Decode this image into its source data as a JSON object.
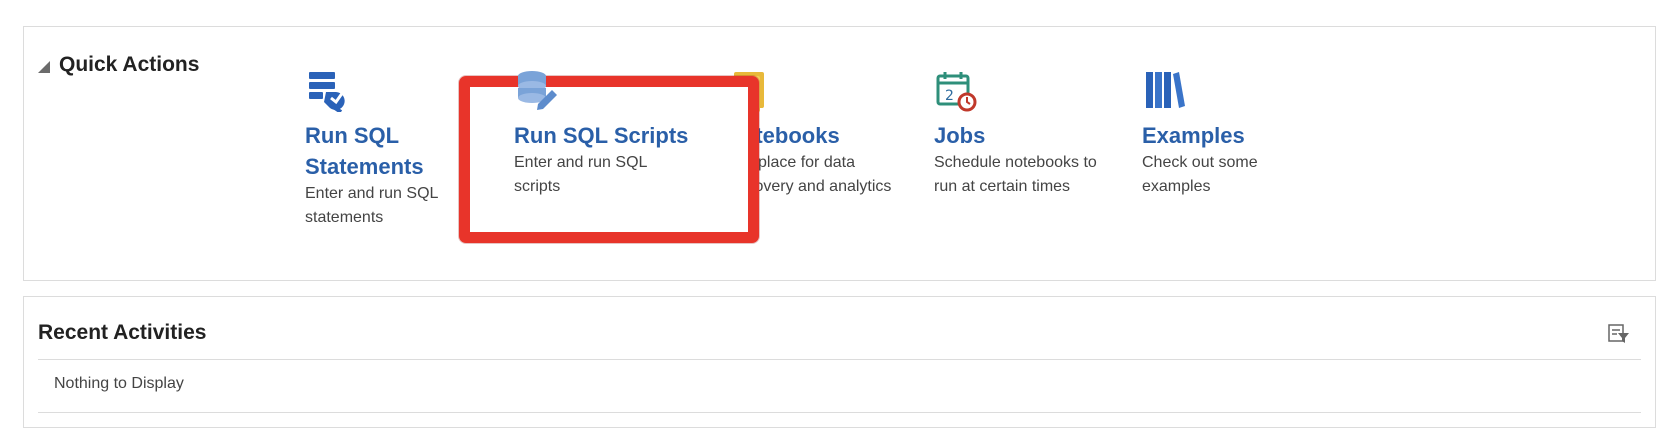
{
  "quick_actions": {
    "title": "Quick Actions",
    "items": [
      {
        "title": "Run SQL\nStatements",
        "title_line1": "Run SQL",
        "title_line2": "Statements",
        "description_line1": "Enter and run SQL",
        "description_line2": "statements",
        "icon": "run-sql-icon"
      },
      {
        "title_line1": "Run SQL Scripts",
        "description_line1": "Enter and run SQL",
        "description_line2": "scripts",
        "icon": "sql-scripts-icon"
      },
      {
        "title_line1": "Notebooks",
        "description_line1": "The place for data",
        "description_line2": "discovery and analytics",
        "icon": "notebooks-icon"
      },
      {
        "title_line1": "Jobs",
        "description_line1": "Schedule notebooks to",
        "description_line2": "run at certain times",
        "icon": "calendar-clock-icon"
      },
      {
        "title_line1": "Examples",
        "description_line1": "Check out some",
        "description_line2": "examples",
        "icon": "books-icon"
      }
    ]
  },
  "recent_activities": {
    "title": "Recent Activities",
    "empty_text": "Nothing to Display",
    "filter_icon": "filter-icon"
  },
  "colors": {
    "accent_link": "#2a5fa8",
    "highlight": "#e8342a"
  }
}
